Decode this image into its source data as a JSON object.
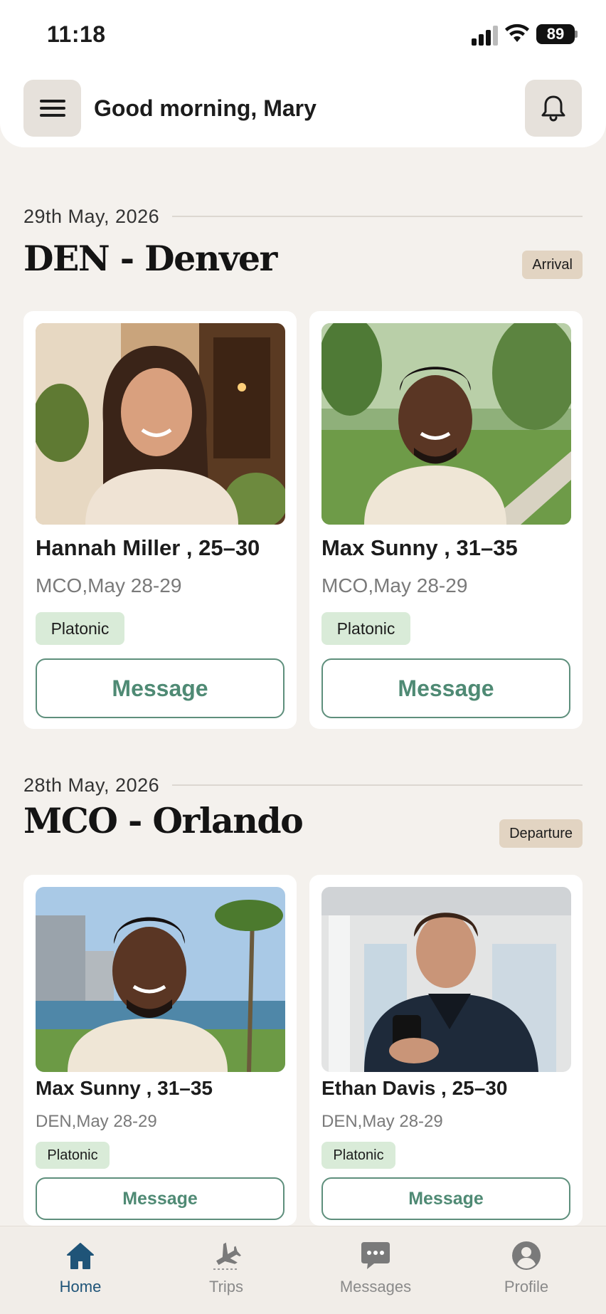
{
  "status_bar": {
    "time": "11:18",
    "battery": "89"
  },
  "header": {
    "greeting": "Good morning, Mary",
    "menu_icon": "hamburger-menu-icon",
    "bell_icon": "bell-icon"
  },
  "sections": [
    {
      "date": "29th May, 2026",
      "city": "DEN - Denver",
      "badge": "Arrival",
      "cards": [
        {
          "name": "Hannah Miller , 25–30",
          "meta": "MCO,May 28-29",
          "tag": "Platonic",
          "button": "Message"
        },
        {
          "name": "Max Sunny , 31–35",
          "meta": "MCO,May 28-29",
          "tag": "Platonic",
          "button": "Message"
        }
      ]
    },
    {
      "date": "28th May, 2026",
      "city": "MCO - Orlando",
      "badge": "Departure",
      "cards": [
        {
          "name": "Max Sunny , 31–35",
          "meta": "DEN,May 28-29",
          "tag": "Platonic",
          "button": "Message"
        },
        {
          "name": "Ethan Davis , 25–30",
          "meta": "DEN,May 28-29",
          "tag": "Platonic",
          "button": "Message"
        }
      ]
    }
  ],
  "bottom_nav": {
    "items": [
      {
        "label": "Home",
        "icon": "home-icon",
        "active": true
      },
      {
        "label": "Trips",
        "icon": "airplane-icon",
        "active": false
      },
      {
        "label": "Messages",
        "icon": "chat-bubble-icon",
        "active": false
      },
      {
        "label": "Profile",
        "icon": "user-circle-icon",
        "active": false
      }
    ]
  },
  "colors": {
    "background": "#f4f1ed",
    "accent_green": "#4f8a74",
    "tag_green": "#d9ebd8",
    "badge_tan": "#e2d4c2",
    "nav_active": "#1f5478"
  }
}
